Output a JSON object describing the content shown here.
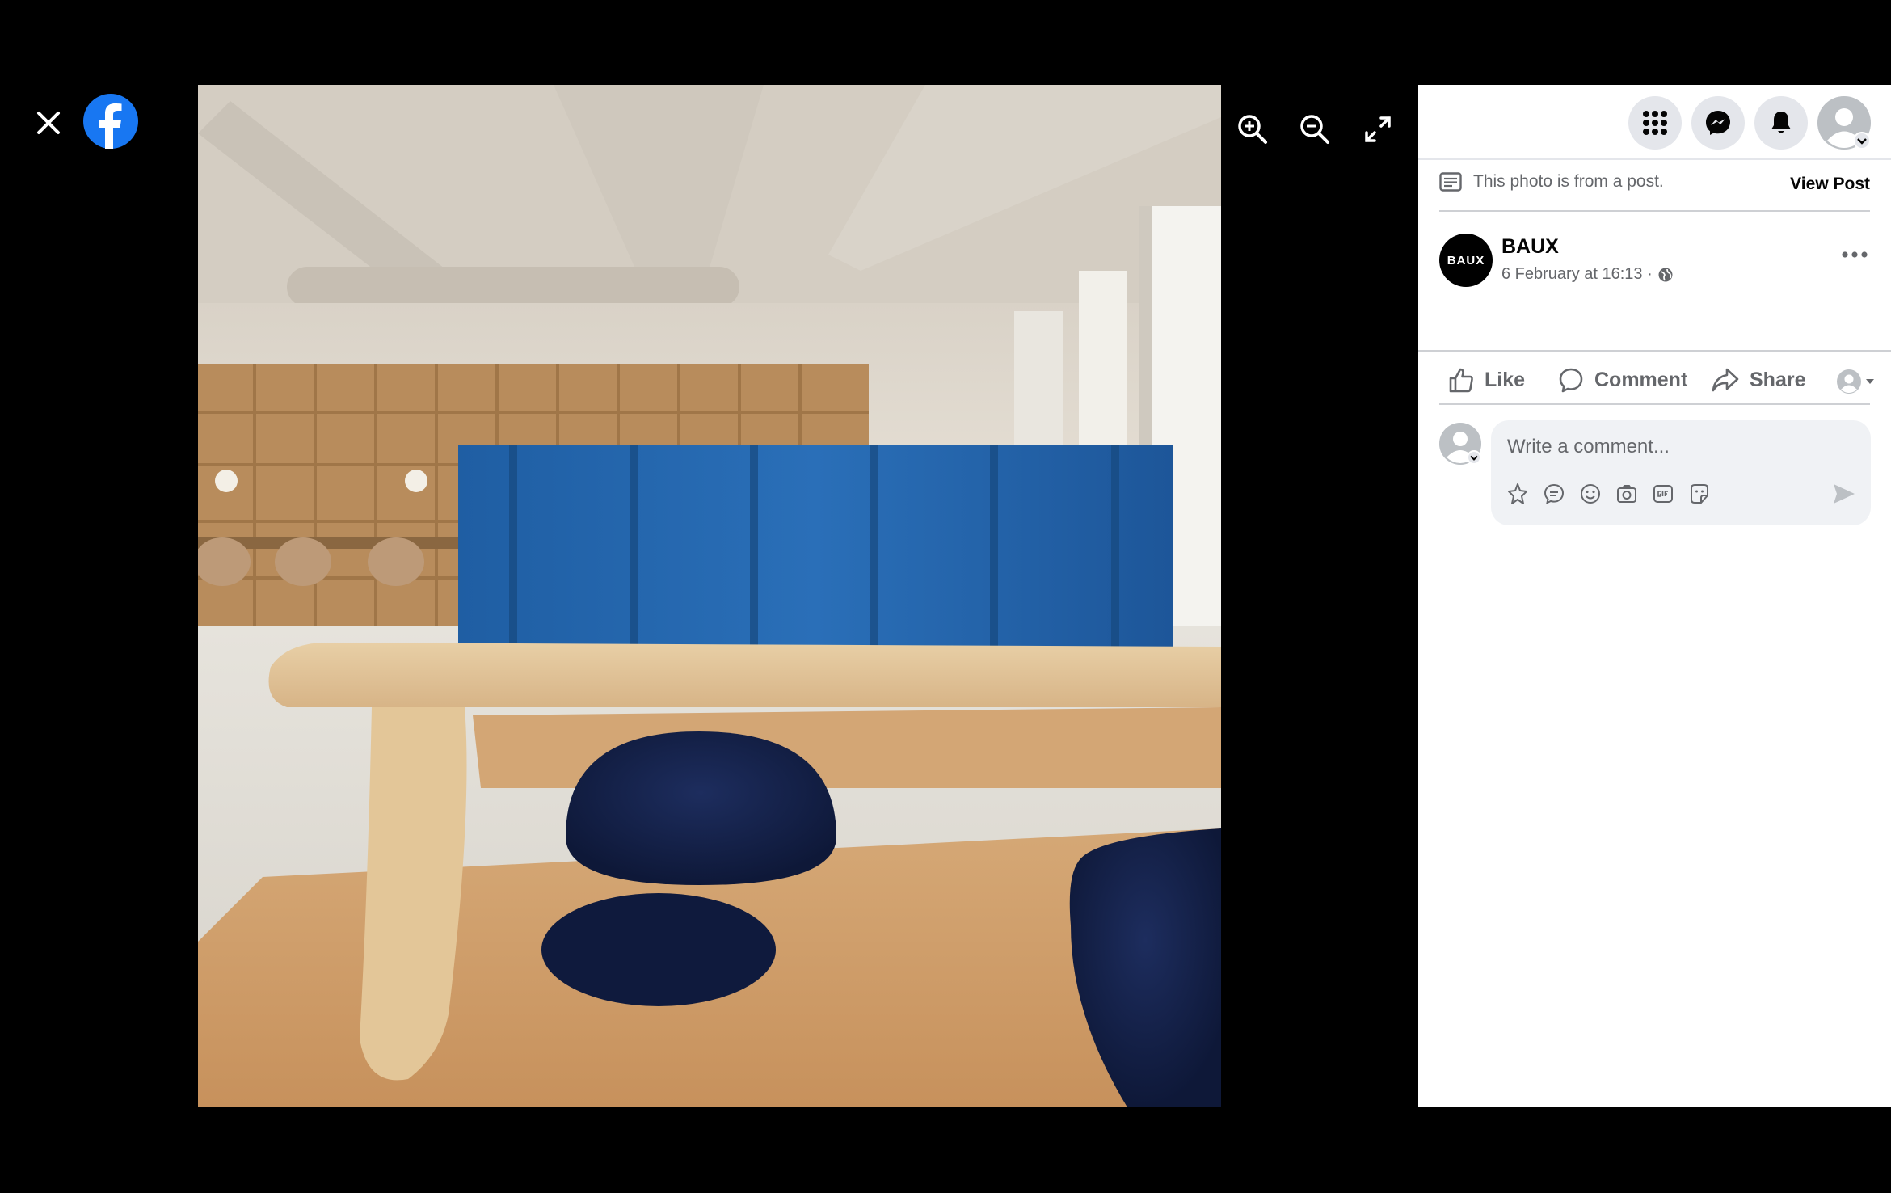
{
  "viewer": {
    "close_icon": "close-icon",
    "logo_icon": "facebook-logo-icon",
    "zoom_in_icon": "zoom-in-icon",
    "zoom_out_icon": "zoom-out-icon",
    "fullscreen_icon": "fullscreen-icon"
  },
  "header": {
    "icons": [
      "menu-grid-icon",
      "messenger-icon",
      "bell-icon",
      "account-icon"
    ]
  },
  "post": {
    "note": "This photo is from a post.",
    "view_post": "View Post",
    "page_avatar_text": "BAUX",
    "page_name": "BAUX",
    "timestamp": "6 February at 16:13 ·",
    "privacy_icon": "globe-icon"
  },
  "actions": {
    "like": "Like",
    "comment": "Comment",
    "share": "Share"
  },
  "comment": {
    "placeholder": "Write a comment...",
    "tool_icons": [
      "avatar-sticker-icon",
      "chat-icon",
      "emoji-icon",
      "camera-icon",
      "gif-icon",
      "sticker-icon",
      "send-icon"
    ]
  },
  "colors": {
    "brand": "#1877F2",
    "secondary_text": "#65676B",
    "panel_bg": "#FFFFFF",
    "button_bg": "#E4E6EB",
    "comment_bg": "#F0F2F5"
  }
}
